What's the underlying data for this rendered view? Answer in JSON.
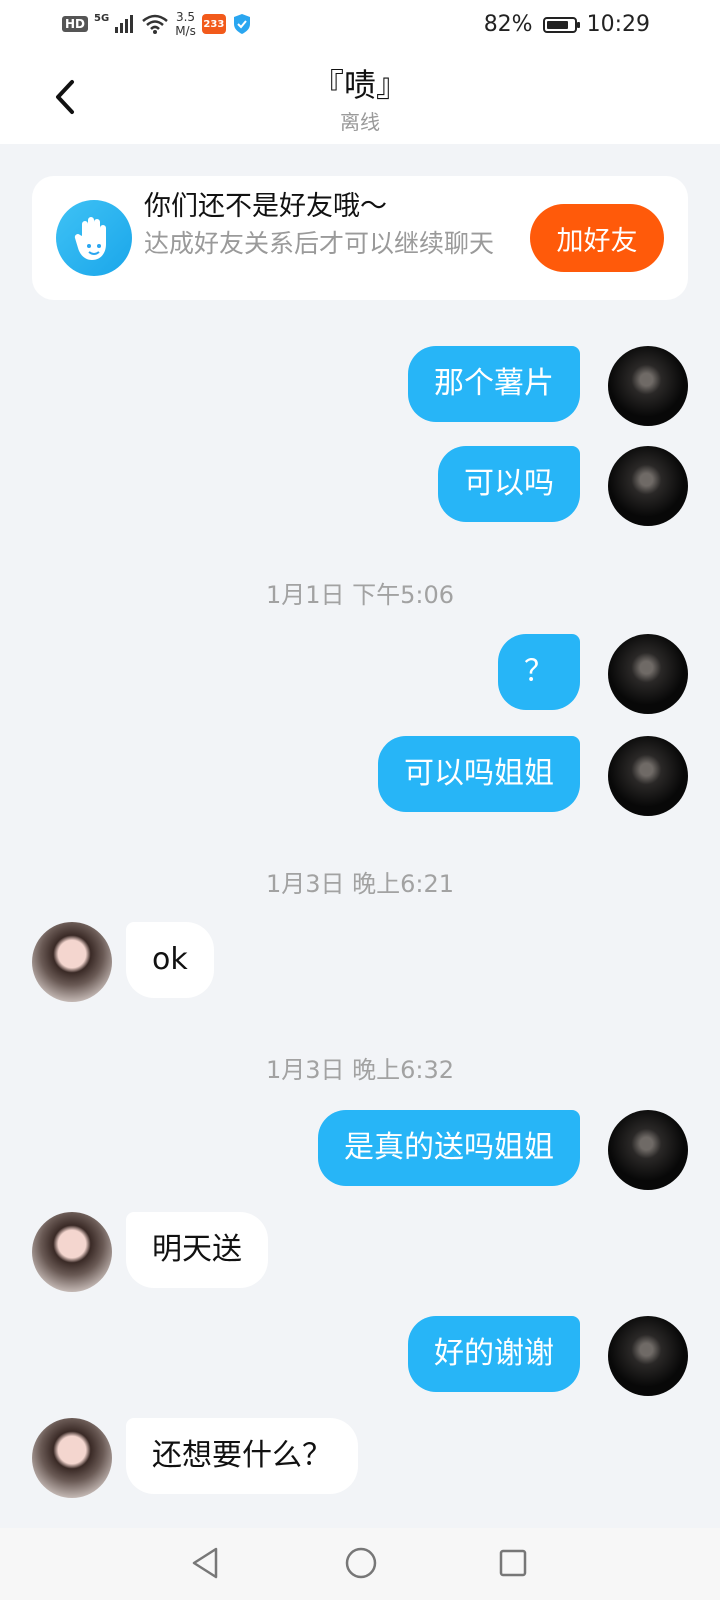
{
  "status_bar": {
    "hd": "HD",
    "signal_label": "5G",
    "net_speed_value": "3.5",
    "net_speed_unit": "M/s",
    "app_badge": "233",
    "battery": "82%",
    "battery_level": 0.82,
    "time": "10:29"
  },
  "header": {
    "title": "『啧』",
    "status": "离线",
    "back_icon": "chevron-left-icon"
  },
  "friend_banner": {
    "icon": "waving-hand-icon",
    "title": "你们还不是好友哦～",
    "description": "达成好友关系后才可以继续聊天",
    "button_label": "加好友"
  },
  "chat": [
    {
      "type": "message",
      "from": "me",
      "text": "那个薯片"
    },
    {
      "type": "message",
      "from": "me",
      "text": "可以吗"
    },
    {
      "type": "timestamp",
      "text": "1月1日 下午5:06"
    },
    {
      "type": "message",
      "from": "me",
      "text": "？"
    },
    {
      "type": "message",
      "from": "me",
      "text": "可以吗姐姐"
    },
    {
      "type": "timestamp",
      "text": "1月3日 晚上6:21"
    },
    {
      "type": "message",
      "from": "other",
      "text": "ok"
    },
    {
      "type": "timestamp",
      "text": "1月3日 晚上6:32"
    },
    {
      "type": "message",
      "from": "me",
      "text": "是真的送吗姐姐"
    },
    {
      "type": "message",
      "from": "other",
      "text": "明天送"
    },
    {
      "type": "message",
      "from": "me",
      "text": "好的谢谢"
    },
    {
      "type": "message",
      "from": "other",
      "text": "还想要什么？"
    }
  ],
  "nav_bar": {
    "back_icon": "triangle-back-icon",
    "home_icon": "circle-home-icon",
    "recents_icon": "square-recents-icon"
  },
  "colors": {
    "accent_blue": "#27b5f7",
    "add_button": "#ff5a0a",
    "background": "#f2f4f7"
  }
}
